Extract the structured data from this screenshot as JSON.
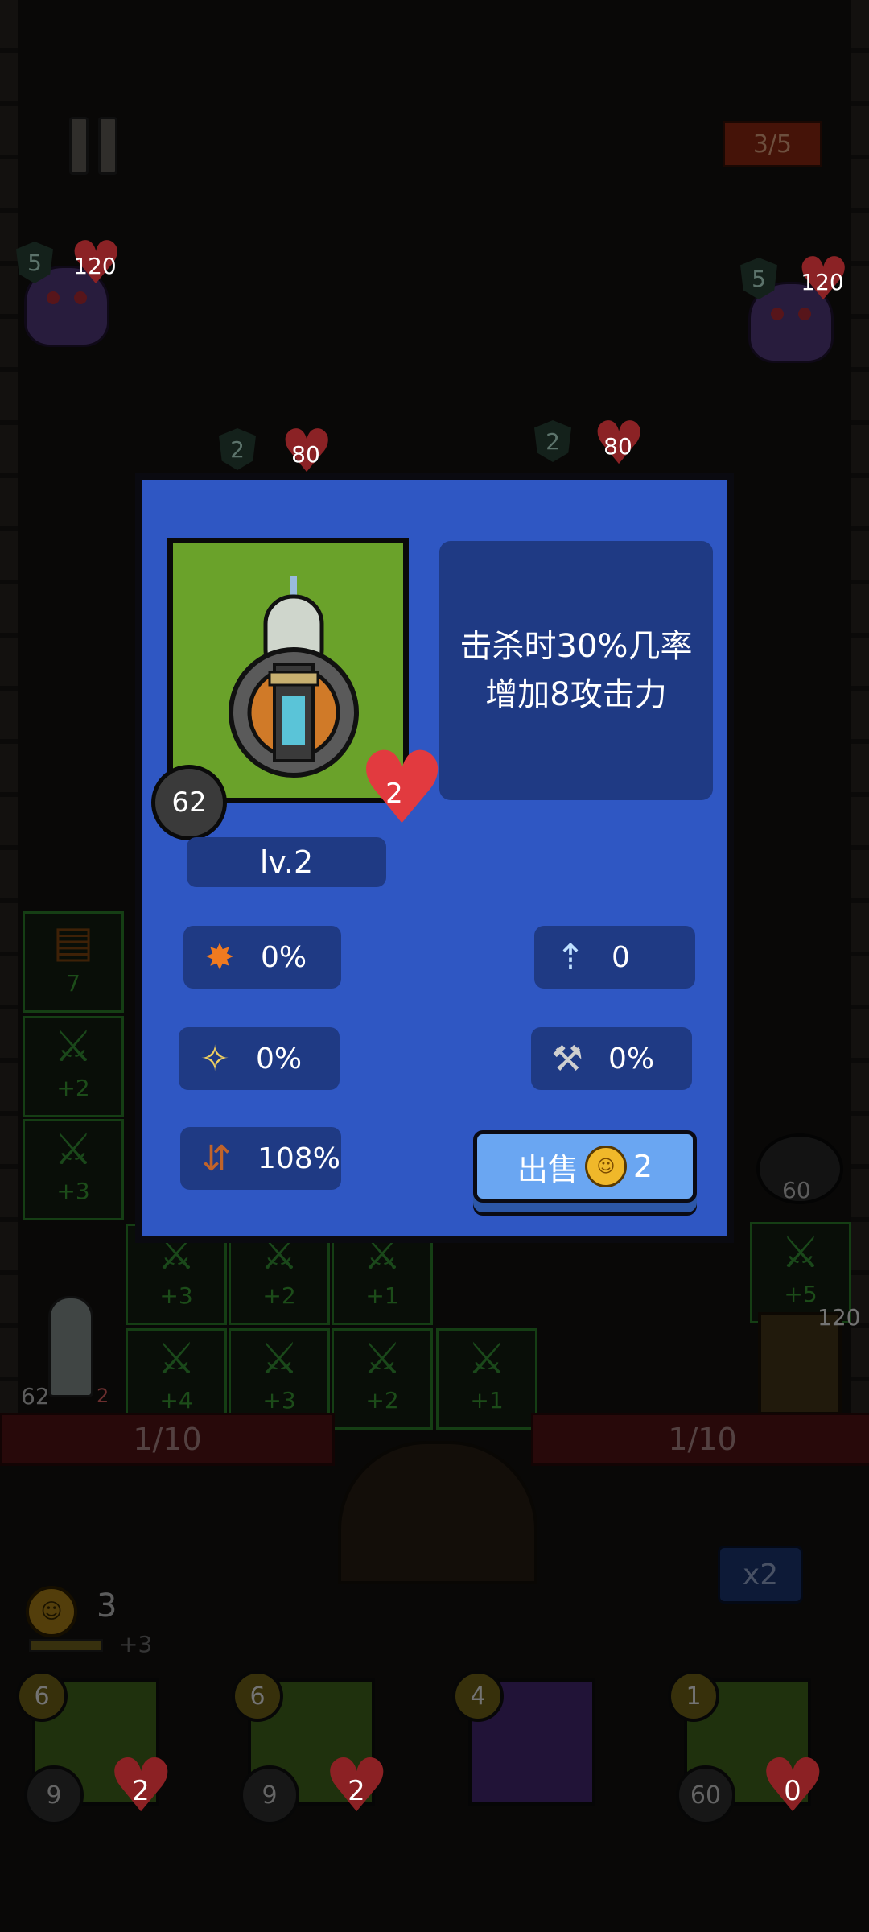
{
  "hud": {
    "wave": "3/5",
    "lane_left": "1/10",
    "lane_right": "1/10",
    "speed": "x2",
    "coins": "3",
    "coin_income": "+3"
  },
  "monsters": [
    {
      "shield": "5",
      "hp": "120"
    },
    {
      "shield": "5",
      "hp": "120"
    },
    {
      "shield": "2",
      "hp": "80"
    },
    {
      "shield": "2",
      "hp": "80"
    }
  ],
  "tiles": {
    "row1": [
      "+2"
    ],
    "row2": [
      "+3"
    ],
    "row3": [
      "+3",
      "+2",
      "+1"
    ],
    "row4": [
      "+4",
      "+3",
      "+2",
      "+1"
    ],
    "right": "+5"
  },
  "field_units": {
    "left_atk": "62",
    "left_hp": "2",
    "chest_hp": "7",
    "right_chest_hp": "120",
    "bomb_atk": "60"
  },
  "cards": [
    {
      "cost": "6",
      "atk": "9",
      "hp": "2"
    },
    {
      "cost": "6",
      "atk": "9",
      "hp": "2"
    },
    {
      "cost": "4",
      "atk": "",
      "hp": ""
    },
    {
      "cost": "1",
      "atk": "60",
      "hp": "0"
    }
  ],
  "dialog": {
    "attack": "62",
    "health": "2",
    "description_line1": "击杀时30%几率",
    "description_line2": "增加8攻击力",
    "level": "lv.2",
    "stats": {
      "crit": "0%",
      "range": "0",
      "stun": "0%",
      "knockback": "0%",
      "speed": "108%"
    },
    "sell_label": "出售",
    "sell_price": "2"
  }
}
